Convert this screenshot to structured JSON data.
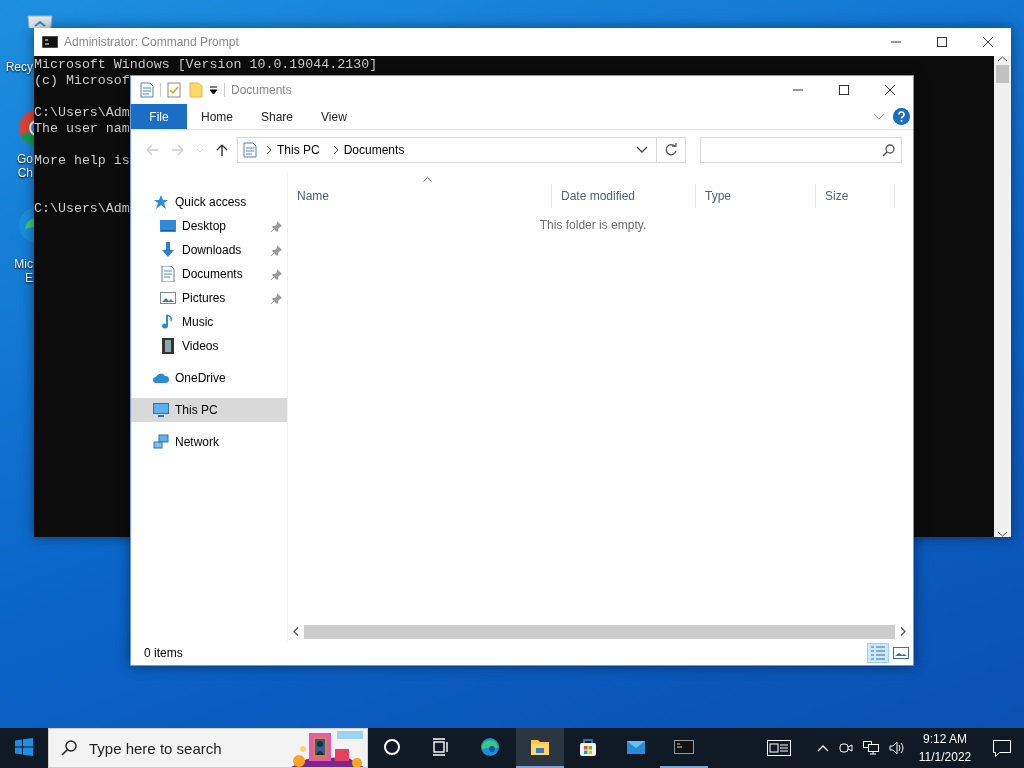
{
  "desktop_icons": [
    {
      "kind": "recycle",
      "lines": [
        "Recy"
      ]
    },
    {
      "kind": "chrome",
      "lines": [
        "Go",
        "Ch"
      ]
    },
    {
      "kind": "edge",
      "lines": [
        "Mic",
        "E"
      ]
    }
  ],
  "console_window": {
    "title": "Administrator: Command Prompt",
    "blocks": [
      {
        "kind": "banner",
        "lines": [
          "Microsoft Windows [Version 10.0.19044.2130]",
          "(c) Microsof"
        ]
      },
      {
        "kind": "command",
        "lines": [
          "C:\\Users\\Adm",
          "The user nam"
        ]
      },
      {
        "kind": "message",
        "lines": [
          "More help is"
        ]
      },
      {
        "kind": "prompt",
        "lines": [
          "C:\\Users\\Adm"
        ]
      }
    ]
  },
  "explorer": {
    "title": "Documents",
    "ribbon_tabs": [
      {
        "label": "File",
        "kind": "file"
      },
      {
        "label": "Home",
        "kind": "tab"
      },
      {
        "label": "Share",
        "kind": "tab"
      },
      {
        "label": "View",
        "kind": "tab"
      }
    ],
    "address": {
      "segments": [
        "This PC",
        "Documents"
      ]
    },
    "nav": [
      {
        "label": "Quick access",
        "kind": "star",
        "selected": false,
        "children": [
          {
            "label": "Desktop",
            "kind": "desktop",
            "pinned": true,
            "selected": false
          },
          {
            "label": "Downloads",
            "kind": "download",
            "pinned": true,
            "selected": false
          },
          {
            "label": "Documents",
            "kind": "document",
            "pinned": true,
            "selected": false
          },
          {
            "label": "Pictures",
            "kind": "pictures",
            "pinned": true,
            "selected": false
          },
          {
            "label": "Music",
            "kind": "music",
            "pinned": false,
            "selected": false
          },
          {
            "label": "Videos",
            "kind": "videos",
            "pinned": false,
            "selected": false
          }
        ]
      },
      {
        "label": "OneDrive",
        "kind": "cloud",
        "selected": false
      },
      {
        "label": "This PC",
        "kind": "pc",
        "selected": true
      },
      {
        "label": "Network",
        "kind": "network",
        "selected": false
      }
    ],
    "columns": [
      {
        "label": "Name",
        "sorted": true
      },
      {
        "label": "Date modified",
        "sorted": false
      },
      {
        "label": "Type",
        "sorted": false
      },
      {
        "label": "Size",
        "sorted": false
      }
    ],
    "empty_message": "This folder is empty.",
    "status": "0 items",
    "views": [
      {
        "kind": "details",
        "selected": true
      },
      {
        "kind": "large",
        "selected": false
      }
    ]
  },
  "taskbar": {
    "search_placeholder": "Type here to search",
    "apps": [
      {
        "kind": "cortana",
        "active": false,
        "running": false
      },
      {
        "kind": "taskview",
        "active": false,
        "running": false
      },
      {
        "kind": "edge",
        "active": false,
        "running": false
      },
      {
        "kind": "folder",
        "active": true,
        "running": true
      },
      {
        "kind": "store",
        "active": false,
        "running": false
      },
      {
        "kind": "mail",
        "active": false,
        "running": false
      },
      {
        "kind": "console",
        "active": false,
        "running": true
      }
    ],
    "time": "9:12 AM",
    "date": "11/1/2022"
  }
}
